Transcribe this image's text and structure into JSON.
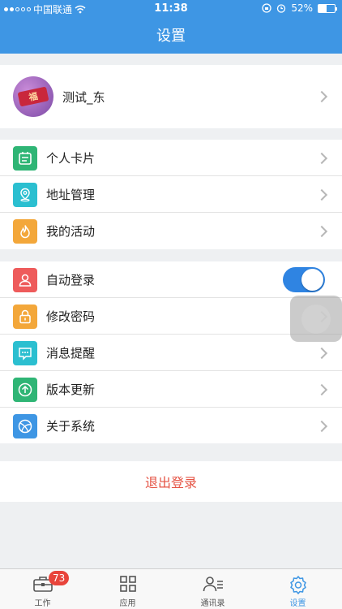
{
  "status_bar": {
    "carrier": "中国联通",
    "time": "11:38",
    "battery": "52%",
    "battery_level": 0.52
  },
  "header": {
    "title": "设置"
  },
  "profile": {
    "name": "测试_东",
    "avatar_text": "福"
  },
  "group1": [
    {
      "label": "个人卡片",
      "icon": "id-card-icon",
      "color": "#2fb575"
    },
    {
      "label": "地址管理",
      "icon": "location-pin-icon",
      "color": "#2bbfd0"
    },
    {
      "label": "我的活动",
      "icon": "flame-icon",
      "color": "#f3a73a"
    }
  ],
  "group2": [
    {
      "label": "自动登录",
      "icon": "user-icon",
      "color": "#ee5b5b",
      "toggle": true
    },
    {
      "label": "修改密码",
      "icon": "lock-icon",
      "color": "#f3a73a"
    },
    {
      "label": "消息提醒",
      "icon": "message-icon",
      "color": "#2bbfd0"
    },
    {
      "label": "版本更新",
      "icon": "upload-icon",
      "color": "#2fb575"
    },
    {
      "label": "关于系统",
      "icon": "globe-icon",
      "color": "#3e96e4"
    }
  ],
  "logout_label": "退出登录",
  "tabs": [
    {
      "label": "工作",
      "icon": "briefcase-icon",
      "badge": "73"
    },
    {
      "label": "应用",
      "icon": "grid-icon"
    },
    {
      "label": "通讯录",
      "icon": "contacts-icon"
    },
    {
      "label": "设置",
      "icon": "gear-icon",
      "active": true
    }
  ],
  "colors": {
    "accent": "#3e96e4",
    "logout": "#e55344",
    "badge": "#e8443b"
  }
}
